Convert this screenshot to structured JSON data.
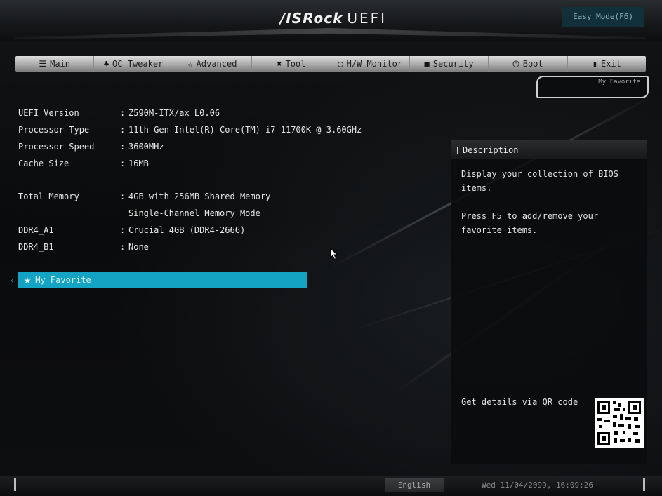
{
  "header": {
    "brand": "/ISRock",
    "brand_suffix": "UEFI",
    "easy_mode_button": "Easy Mode(F6)"
  },
  "tabs": [
    {
      "label": "Main",
      "icon": "list-icon",
      "glyph": "☰"
    },
    {
      "label": "OC Tweaker",
      "icon": "fan-icon",
      "glyph": "♣"
    },
    {
      "label": "Advanced",
      "icon": "star-icon",
      "glyph": "☆"
    },
    {
      "label": "Tool",
      "icon": "tools-icon",
      "glyph": "✖"
    },
    {
      "label": "H/W Monitor",
      "icon": "monitor-icon",
      "glyph": "◯"
    },
    {
      "label": "Security",
      "icon": "shield-icon",
      "glyph": "■"
    },
    {
      "label": "Boot",
      "icon": "power-icon",
      "glyph": "⏻"
    },
    {
      "label": "Exit",
      "icon": "exit-icon",
      "glyph": "▮"
    }
  ],
  "favorite_badge": "My Favorite",
  "info": {
    "uefi_version": {
      "label": "UEFI Version",
      "value": "Z590M-ITX/ax L0.06"
    },
    "processor_type": {
      "label": "Processor Type",
      "value": "11th Gen Intel(R) Core(TM) i7-11700K @ 3.60GHz"
    },
    "processor_speed": {
      "label": "Processor Speed",
      "value": "3600MHz"
    },
    "cache_size": {
      "label": "Cache Size",
      "value": "16MB"
    },
    "total_memory": {
      "label": "Total Memory",
      "value": "4GB with 256MB Shared Memory",
      "value2": "Single-Channel Memory Mode"
    },
    "ddr4_a1": {
      "label": "DDR4_A1",
      "value": "Crucial 4GB (DDR4-2666)"
    },
    "ddr4_b1": {
      "label": "DDR4_B1",
      "value": "None"
    }
  },
  "favorite_item": "My Favorite",
  "description": {
    "title": "Description",
    "line1": "Display your collection of BIOS items.",
    "line2": "Press F5 to add/remove your favorite items.",
    "qr_label": "Get details via QR code"
  },
  "footer": {
    "language": "English",
    "datetime": "Wed 11/04/2099, 16:09:26"
  },
  "colors": {
    "accent": "#14a3c2",
    "easy_mode_bg": "#12303a"
  }
}
